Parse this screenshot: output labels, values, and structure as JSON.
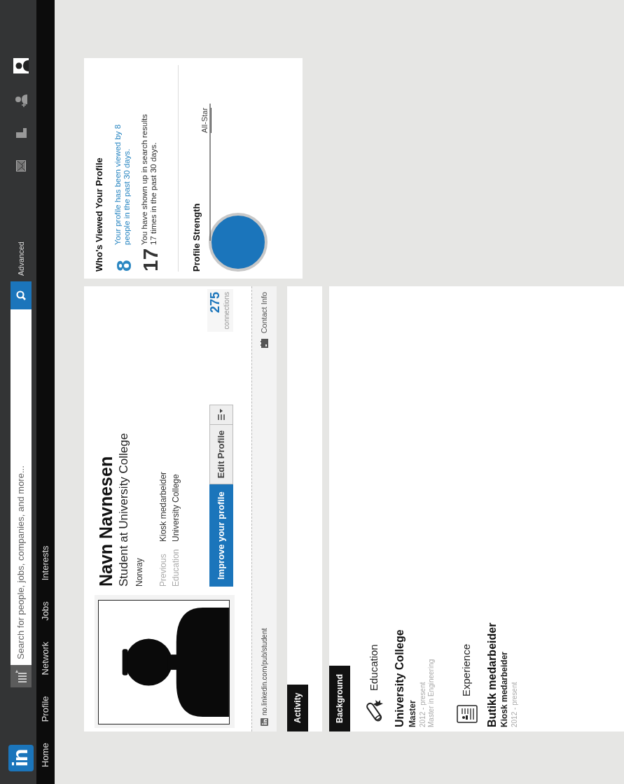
{
  "navbar": {
    "logo": "in",
    "search": {
      "placeholder": "Search for people, jobs, companies, and more..."
    },
    "advanced": "Advanced",
    "nav_items": [
      {
        "label": "Home"
      },
      {
        "label": "Profile"
      },
      {
        "label": "Network"
      },
      {
        "label": "Jobs"
      },
      {
        "label": "Interests"
      }
    ]
  },
  "profile": {
    "name": "Navn Navnesen",
    "headline": "Student at University College",
    "location": "Norway",
    "details": [
      {
        "label": "Previous",
        "value": "Kiosk medarbeider"
      },
      {
        "label": "Education",
        "value": "University College"
      }
    ],
    "improve_button": "Improve your profile",
    "edit_button": "Edit Profile",
    "connections": {
      "count": "275",
      "label": "connections"
    },
    "url": "no.linkedin.com/pub/student",
    "contact": "Contact Info"
  },
  "activity": {
    "title": "Activity"
  },
  "background": {
    "title": "Background",
    "sections": [
      {
        "kind": "education",
        "title": "Education",
        "entries": [
          {
            "title": "University College",
            "subtitle": "Master",
            "lines": [
              "2012 - present",
              "Master in Engineering"
            ]
          }
        ]
      },
      {
        "kind": "experience",
        "title": "Experience",
        "entries": [
          {
            "title": "Butikk medarbeider",
            "subtitle": "Kiosk medarbeider",
            "lines": [
              "2012 - present"
            ]
          }
        ]
      }
    ]
  },
  "viewers": {
    "title": "Who's Viewed Your Profile",
    "stats": [
      {
        "number": "8",
        "text": "Your profile has been viewed by 8 people in the past 30 days.",
        "kind": "link"
      },
      {
        "number": "17",
        "text": "You have shown up in search results 17 times in the past 30 days.",
        "kind": "plain"
      }
    ],
    "strength": {
      "title": "Profile Strength",
      "rank": "All-Star"
    }
  }
}
